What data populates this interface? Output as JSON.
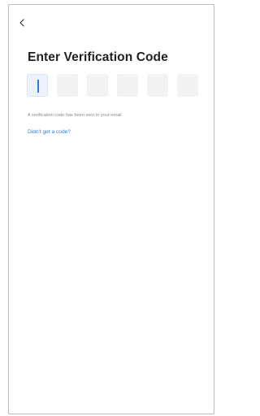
{
  "header": {
    "back_icon": "chevron-left-icon"
  },
  "main": {
    "title": "Enter Verification Code",
    "code_boxes": [
      "",
      "",
      "",
      "",
      "",
      ""
    ],
    "active_index": 0,
    "hint_text": "A verification code has been sent to your email",
    "resend_link": "Didn't get a code?"
  },
  "colors": {
    "accent": "#2f7be5",
    "box_bg": "#f3f3f3",
    "hint": "#8a8a8a"
  }
}
